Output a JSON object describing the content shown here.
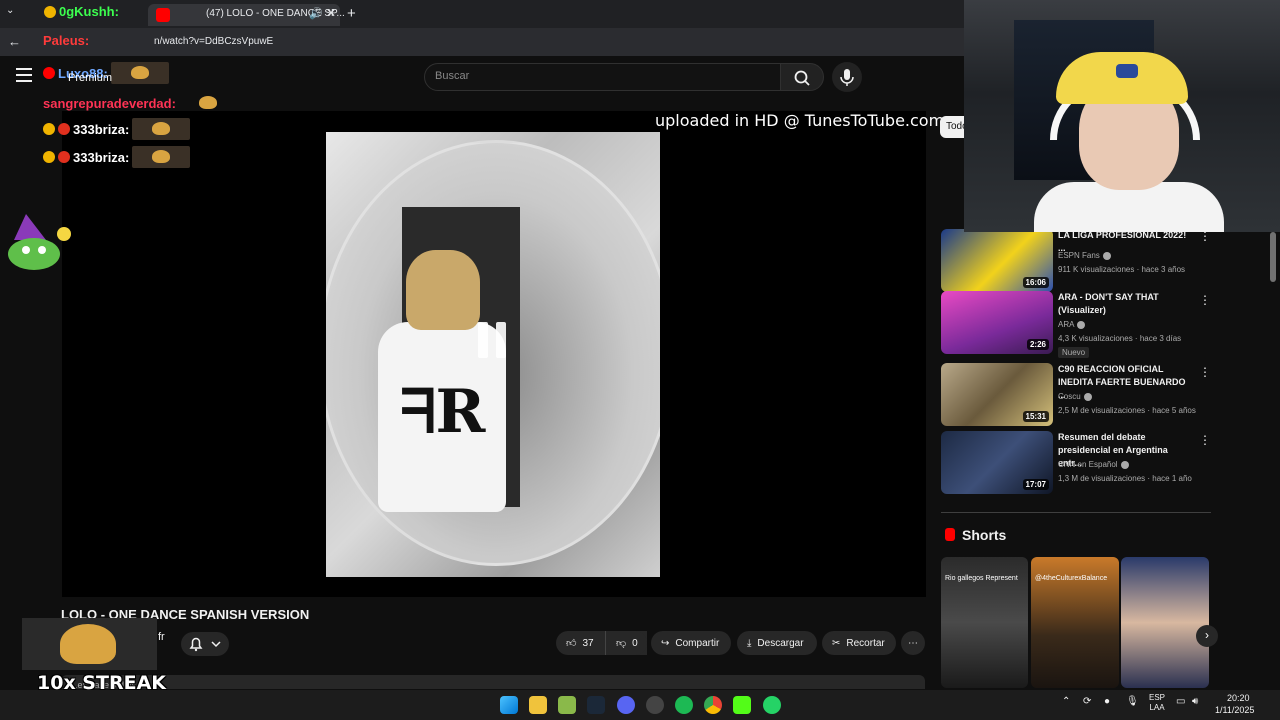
{
  "browser": {
    "tab_title": "(47) LOLO - ONE DANCE SP...",
    "tab_close": "✕",
    "new_tab": "+",
    "url": "n/watch?v=DdBCzsVpuwE"
  },
  "youtube": {
    "search_placeholder": "Buscar",
    "video": {
      "watermark": "uploaded in HD @ TunesToTube.com",
      "title": "LOLO - ONE DANCE SPANISH VERSION",
      "channel_fragment": "fr",
      "likes": "37",
      "dislikes": "0",
      "share_label": "Compartir",
      "download_label": "Descargar",
      "clip_label": "Recortar",
      "description_fragment": "...es  hace 3 días"
    },
    "sidebar": {
      "chip": "Todo",
      "recommendations": [
        {
          "title": "LA LIGA PROFESIONAL 2022! ...",
          "channel": "ESPN Fans",
          "meta": "911 K visualizaciones · hace 3 años",
          "duration": "16:06",
          "badge": ""
        },
        {
          "title": "ARA - DON'T SAY THAT (Visualizer)",
          "channel": "ARA",
          "meta": "4,3 K visualizaciones · hace 3 días",
          "duration": "2:26",
          "badge": "Nuevo"
        },
        {
          "title": "C90 REACCION OFICIAL INEDITA FAERTE BUENARDO ...",
          "channel": "Coscu",
          "meta": "2,5 M de visualizaciones · hace 5 años",
          "duration": "15:31",
          "badge": ""
        },
        {
          "title": "Resumen del debate presidencial en Argentina entr...",
          "channel": "CNN en Español",
          "meta": "1,3 M de visualizaciones · hace 1 año",
          "duration": "17:07",
          "badge": ""
        }
      ],
      "shorts_title": "Shorts",
      "shorts": [
        {
          "caption": "Rio gallegos Represent"
        },
        {
          "caption": "@4theCulturexBalance"
        },
        {
          "caption": ""
        }
      ]
    }
  },
  "stream_overlay": {
    "chat": [
      {
        "user": "0gKushh:",
        "color": "#3cff4f"
      },
      {
        "user": "Paleus:",
        "color": "#ff3b3b"
      },
      {
        "user": "Luxo88:",
        "color": "#6fa8ff"
      },
      {
        "user": "sangrepuradeverdad:",
        "color": "#ff3355"
      },
      {
        "user": "333briza:",
        "color": "#ffffff"
      },
      {
        "user": "333briza:",
        "color": "#ffffff"
      }
    ],
    "premium_label": "Premium",
    "streak": "10x STREAK"
  },
  "taskbar": {
    "lang_line1": "ESP",
    "lang_line2": "LAA",
    "time": "20:20",
    "date": "1/11/2025"
  },
  "colors": {
    "youtube_red": "#ff0000",
    "background": "#0f0f0f",
    "chip_bg": "#272727"
  }
}
